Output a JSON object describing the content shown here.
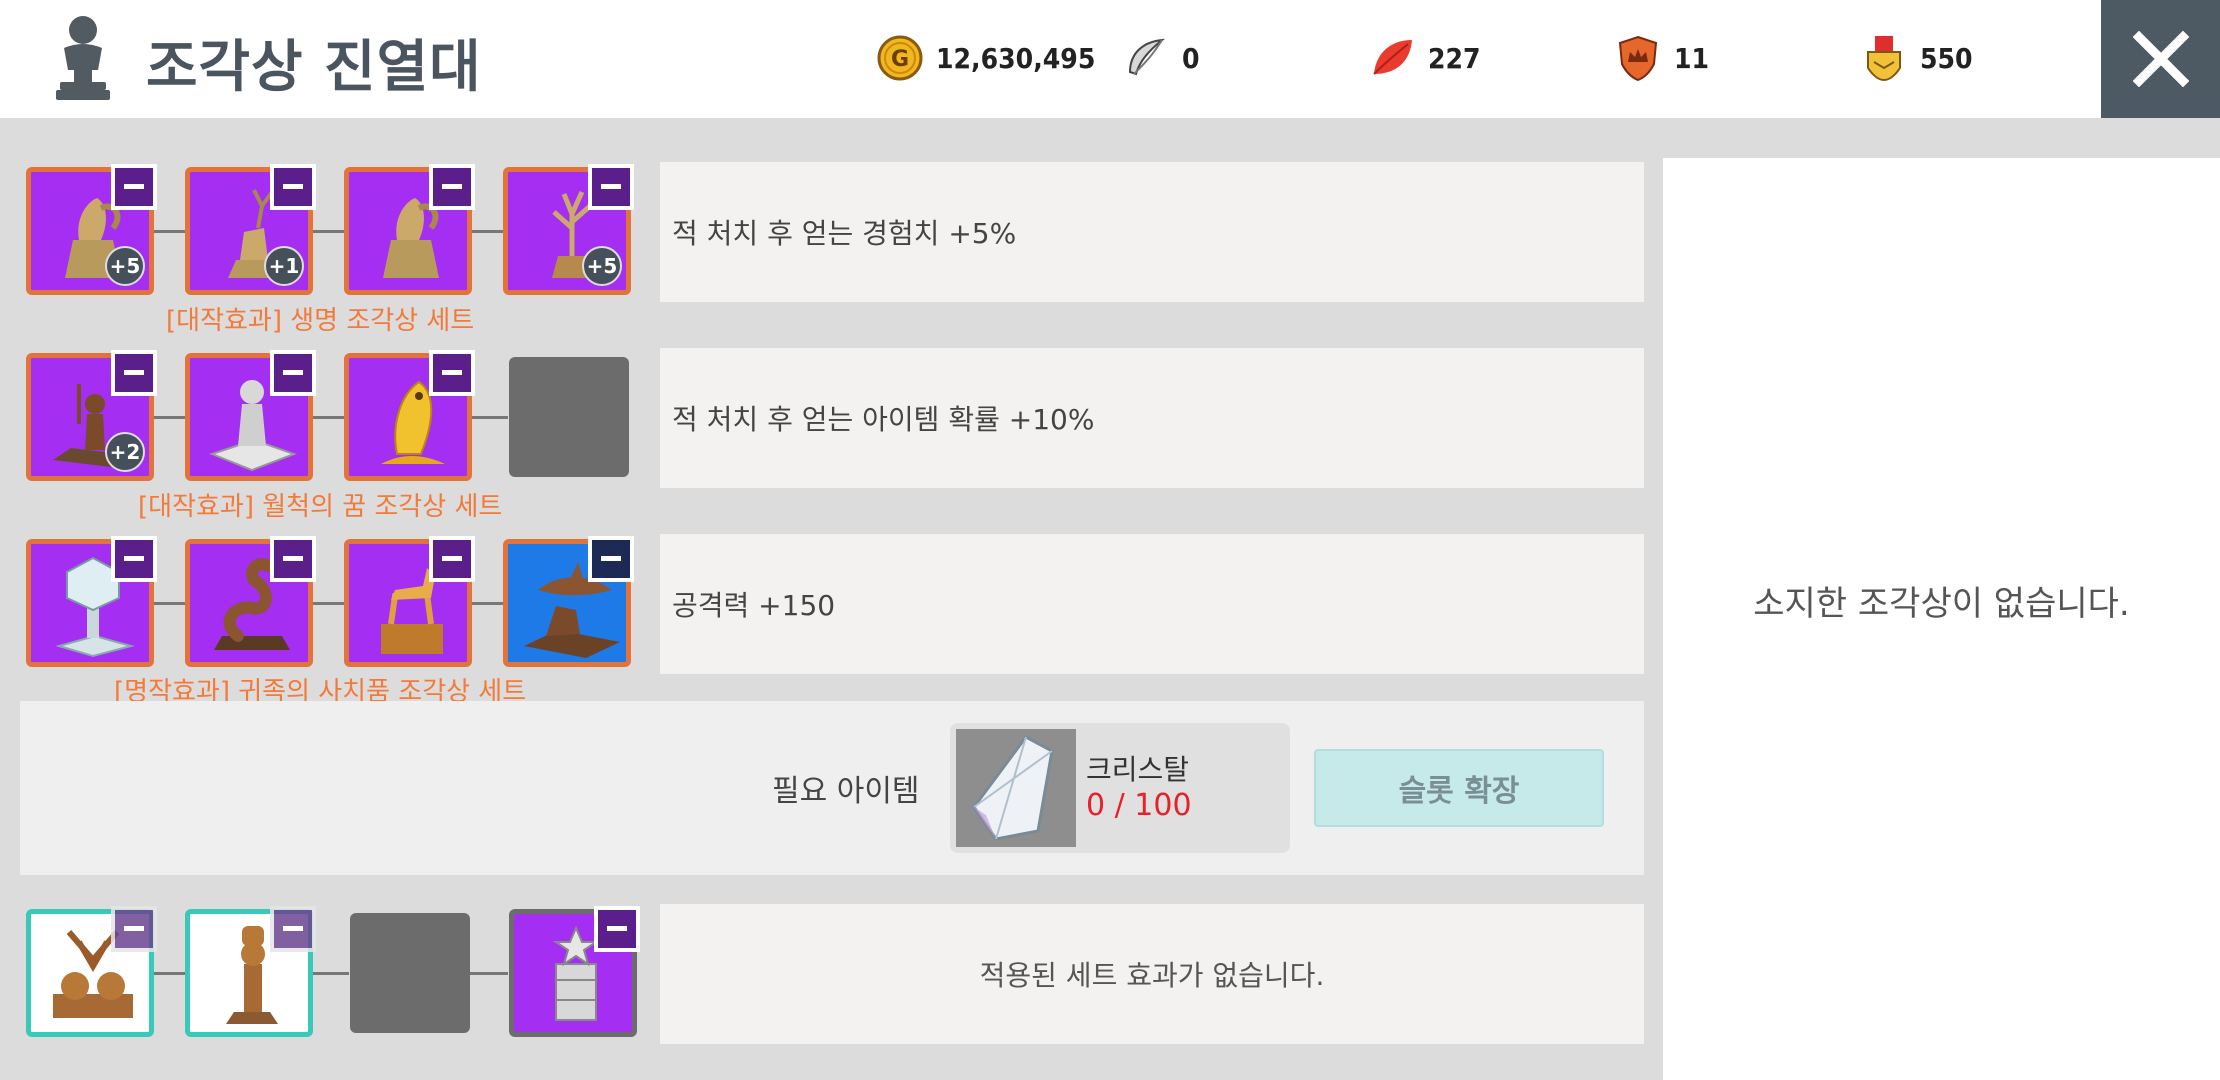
{
  "header": {
    "title": "조각상 진열대",
    "gold": "12,630,495",
    "feather": "0",
    "leaf": "227",
    "shield": "11",
    "medal": "550"
  },
  "rows": [
    {
      "slots": [
        {
          "icon": "squirrel-statue-icon",
          "badge": "+5"
        },
        {
          "icon": "deer-statue-icon",
          "badge": "+1"
        },
        {
          "icon": "squirrel-statue-icon",
          "badge": ""
        },
        {
          "icon": "tree-statue-icon",
          "badge": "+5"
        }
      ],
      "set_name": "[대작효과] 생명 조각상 세트",
      "effect": "적 처치 후 얻는 경험치  +5%"
    },
    {
      "slots": [
        {
          "icon": "warrior-statue-icon",
          "badge": "+2"
        },
        {
          "icon": "stone-figure-statue-icon",
          "badge": ""
        },
        {
          "icon": "golden-fish-statue-icon",
          "badge": ""
        }
      ],
      "set_name": "[대작효과] 월척의 꿈 조각상 세트",
      "effect": "적 처치 후 얻는 아이템 확률  +10%"
    },
    {
      "slots": [
        {
          "icon": "ice-cube-statue-icon",
          "badge": ""
        },
        {
          "icon": "dragon-statue-icon",
          "badge": ""
        },
        {
          "icon": "horse-statue-icon",
          "badge": ""
        },
        {
          "icon": "shark-statue-icon",
          "badge": ""
        }
      ],
      "set_name": "[명작효과] 귀족의 사치품 조각상 세트",
      "effect": "공격력  +150"
    },
    {
      "slots": [
        {
          "icon": "bread-statue-icon",
          "badge": ""
        },
        {
          "icon": "chef-statue-icon",
          "badge": ""
        },
        {
          "icon": "pillar-statue-icon",
          "badge": ""
        }
      ],
      "effect": "적용된 세트 효과가 없습니다."
    }
  ],
  "expand": {
    "required_label": "필요 아이템",
    "item_name": "크리스탈",
    "item_count": "0 / 100",
    "button_label": "슬롯 확장"
  },
  "right_panel": {
    "empty_message": "소지한 조각상이 없습니다."
  },
  "colors": {
    "accent_orange": "#f47a3a",
    "slot_purple": "#a42ff2",
    "slot_blue": "#1e7ae6",
    "header_dark": "#4d5a63",
    "count_red": "#e8202a"
  }
}
